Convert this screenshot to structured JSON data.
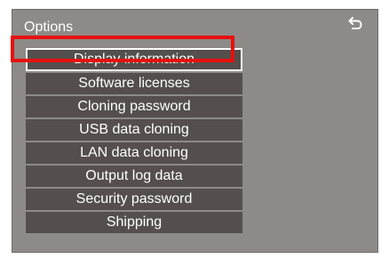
{
  "header": {
    "title": "Options"
  },
  "menu": {
    "items": [
      {
        "label": "Display information"
      },
      {
        "label": "Software licenses"
      },
      {
        "label": "Cloning password"
      },
      {
        "label": "USB data cloning"
      },
      {
        "label": "LAN data cloning"
      },
      {
        "label": "Output log data"
      },
      {
        "label": "Security password"
      },
      {
        "label": "Shipping"
      }
    ]
  },
  "colors": {
    "panel_bg": "#8d8a87",
    "item_bg": "#544f4c",
    "highlight_box": "#e8100e",
    "text": "#ffffff"
  },
  "icons": {
    "back": "back-arrow-icon"
  }
}
